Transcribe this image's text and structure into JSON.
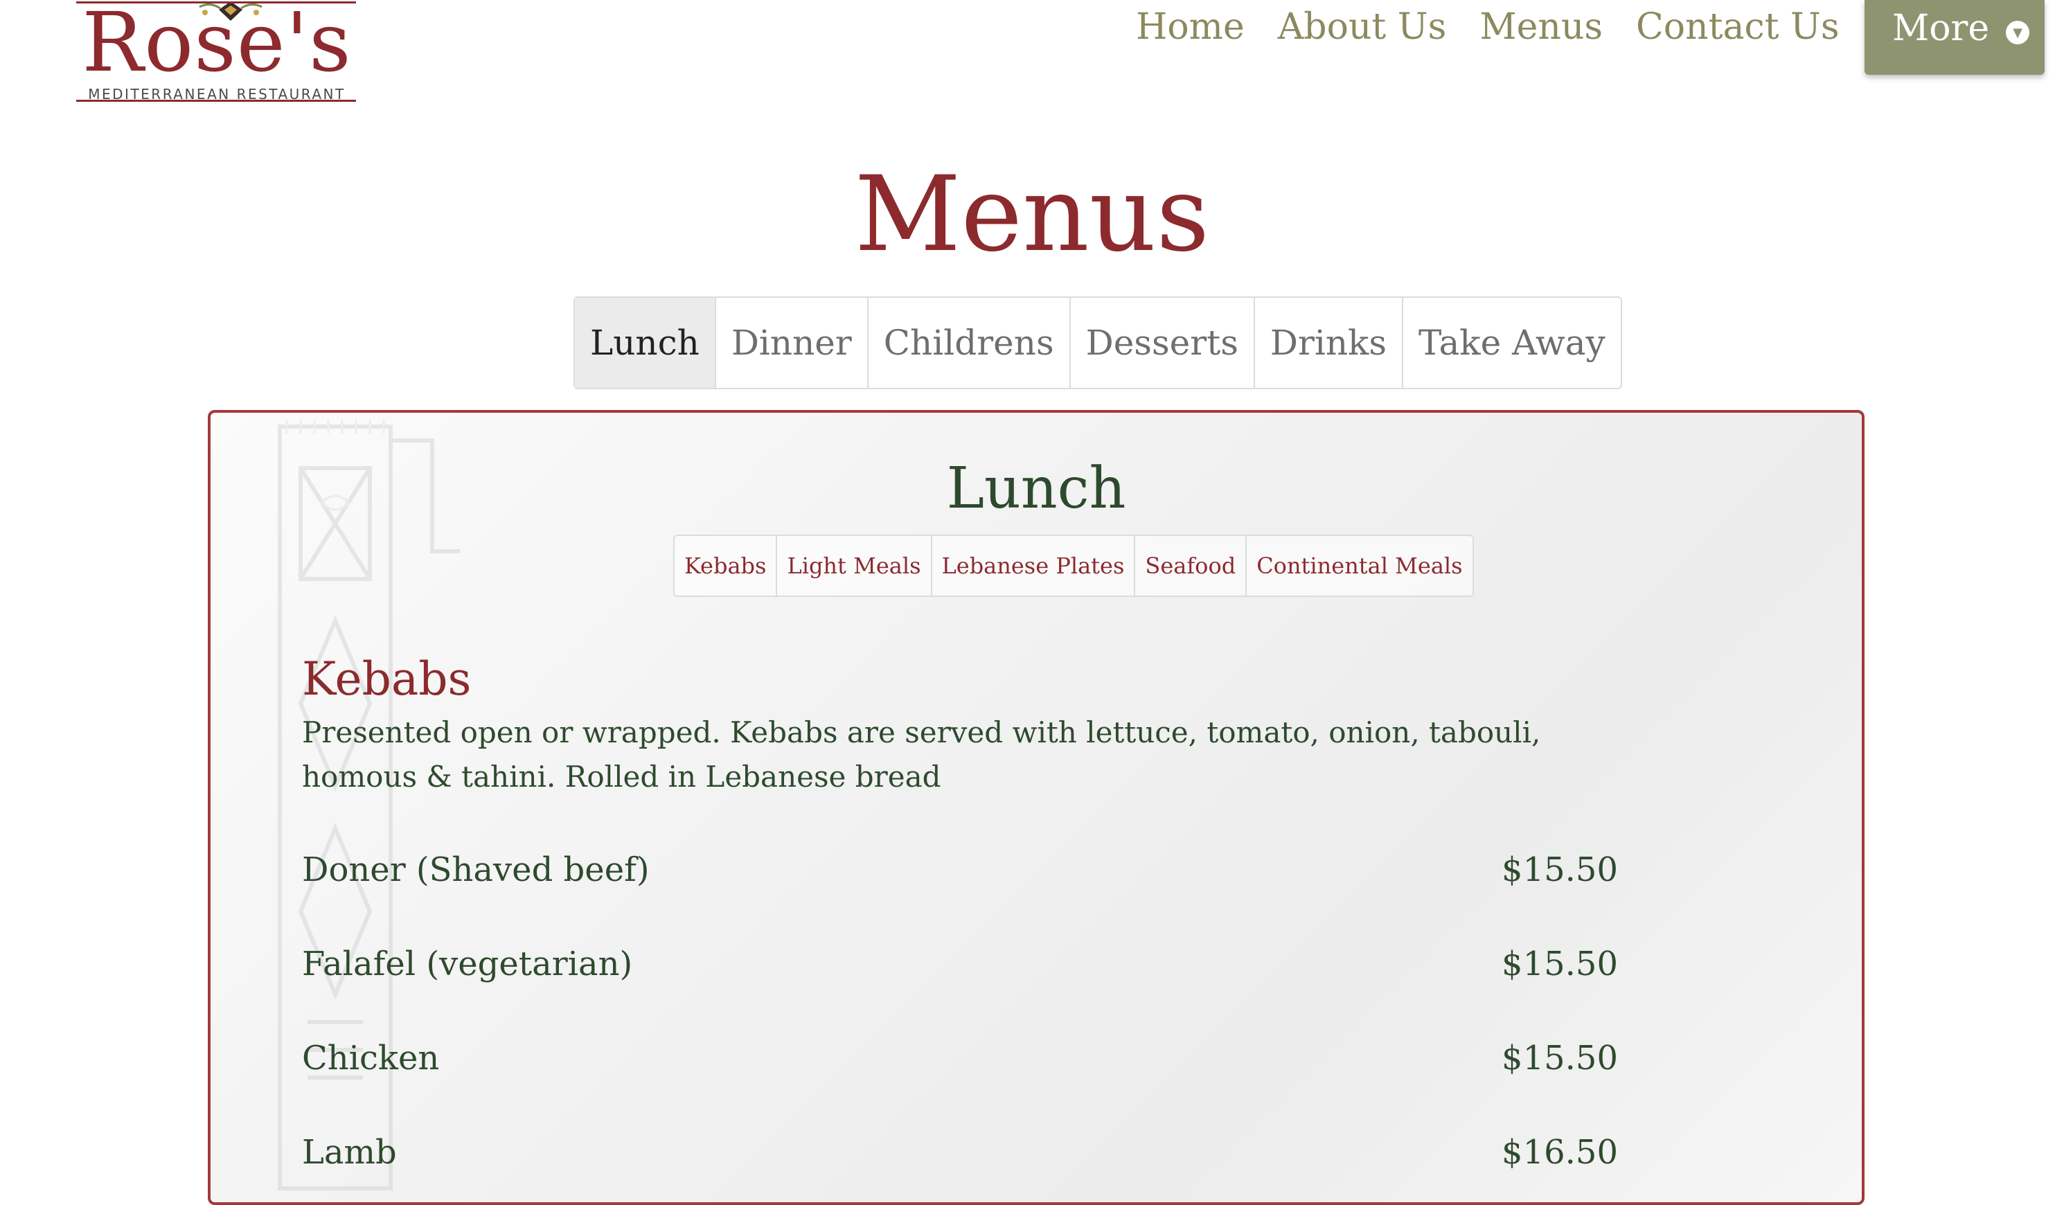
{
  "logo": {
    "name": "Rose's",
    "tagline": "MEDITERRANEAN RESTAURANT"
  },
  "nav": {
    "items": [
      "Home",
      "About Us",
      "Menus",
      "Contact Us"
    ],
    "more_label": "More",
    "more_icon": "chevron-down-icon"
  },
  "page_title": "Menus",
  "main_tabs": [
    "Lunch",
    "Dinner",
    "Childrens",
    "Desserts",
    "Drinks",
    "Take Away"
  ],
  "active_tab": "Lunch",
  "section": {
    "title": "Lunch",
    "sub_tabs": [
      "Kebabs",
      "Light Meals",
      "Lebanese Plates",
      "Seafood",
      "Continental Meals"
    ],
    "category": {
      "title": "Kebabs",
      "description": "Presented open or wrapped. Kebabs are served with lettuce, tomato, onion, tabouli, homous & tahini. Rolled in Lebanese bread",
      "items": [
        {
          "name": "Doner (Shaved beef)",
          "price": "$15.50"
        },
        {
          "name": "Falafel (vegetarian)",
          "price": "$15.50"
        },
        {
          "name": "Chicken",
          "price": "$15.50"
        },
        {
          "name": "Lamb",
          "price": "$16.50"
        }
      ]
    }
  },
  "colors": {
    "brand_red": "#8c2a2e",
    "nav_olive": "#8b8a5e",
    "more_button": "#8e9470",
    "menu_text_green": "#2e4a2e",
    "panel_border": "#a3393c"
  }
}
